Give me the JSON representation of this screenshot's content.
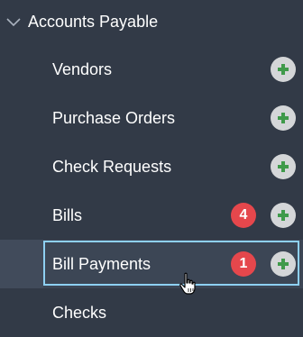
{
  "section": {
    "title": "Accounts Payable",
    "expanded": true,
    "chevron_icon": "chevron-down-icon"
  },
  "items": [
    {
      "label": "Vendors",
      "badge": null,
      "add_icon": "plus-icon"
    },
    {
      "label": "Purchase Orders",
      "badge": null,
      "add_icon": "plus-icon"
    },
    {
      "label": "Check Requests",
      "badge": null,
      "add_icon": "plus-icon"
    },
    {
      "label": "Bills",
      "badge": "4",
      "add_icon": "plus-icon"
    },
    {
      "label": "Bill Payments",
      "badge": "1",
      "add_icon": "plus-icon",
      "active": true
    },
    {
      "label": "Checks",
      "badge": null,
      "add_icon": null
    }
  ],
  "colors": {
    "background": "#323a47",
    "active_background": "#3c4655",
    "focus_border": "#8ed0f2",
    "badge": "#e5474c",
    "add_button": "#d4d6d8",
    "plus": "#3f9a4a"
  },
  "cursor_icon": "hand-pointer-icon"
}
